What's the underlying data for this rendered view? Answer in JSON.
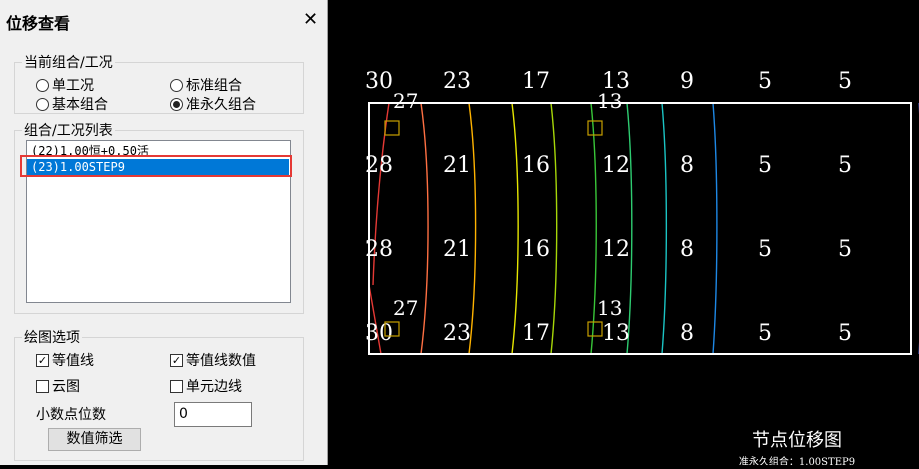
{
  "panel": {
    "title": "位移查看",
    "close": "✕",
    "current_group": {
      "label": "当前组合/工况",
      "options": [
        {
          "label": "单工况",
          "checked": false
        },
        {
          "label": "标准组合",
          "checked": false
        },
        {
          "label": "基本组合",
          "checked": false
        },
        {
          "label": "准永久组合",
          "checked": true
        }
      ]
    },
    "list": {
      "label": "组合/工况列表",
      "items": [
        {
          "text": "(22)1.00恒+0.50活",
          "selected": false
        },
        {
          "text": "(23)1.00STEP9",
          "selected": true
        }
      ]
    },
    "draw_options": {
      "label": "绘图选项",
      "checks": [
        {
          "label": "等值线",
          "checked": true
        },
        {
          "label": "等值线数值",
          "checked": true
        },
        {
          "label": "云图",
          "checked": false
        },
        {
          "label": "单元边线",
          "checked": false
        }
      ],
      "decimal_label": "小数点位数",
      "decimal_value": "0",
      "filter_button": "数值筛选"
    }
  },
  "canvas": {
    "title": "节点位移图",
    "subtitle": "准永久组合：1.00STEP9",
    "rows": [
      [
        "30",
        "23",
        "17",
        "13",
        "9",
        "5",
        "5"
      ],
      [
        "28",
        "21",
        "16",
        "12",
        "8",
        "5",
        "5"
      ],
      [
        "28",
        "21",
        "16",
        "12",
        "8",
        "5",
        "5"
      ],
      [
        "30",
        "23",
        "17",
        "13",
        "8",
        "5",
        "5"
      ]
    ],
    "inner_labels": {
      "top_left": "27",
      "top_mid": "13",
      "bottom_left": "27",
      "bottom_mid": "13"
    },
    "contour_colors": [
      "#e53935",
      "#ff7043",
      "#ffb300",
      "#e6e600",
      "#a6d608",
      "#39c639",
      "#2ecc71",
      "#1bc4c4",
      "#1e88e5",
      "#3949ab"
    ]
  }
}
